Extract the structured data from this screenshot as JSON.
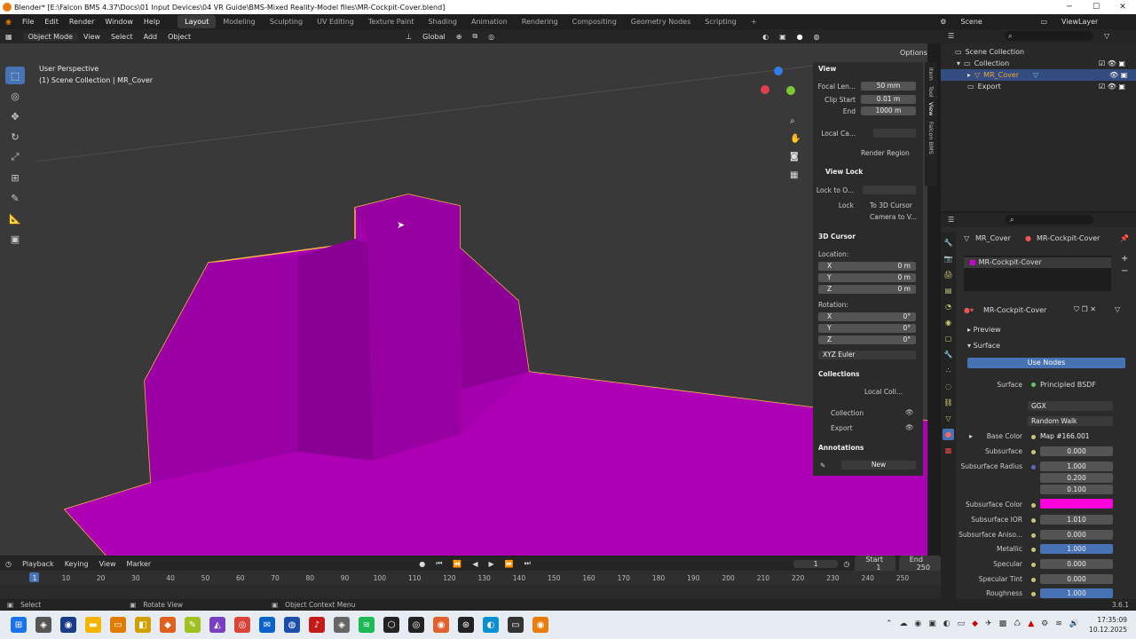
{
  "window": {
    "title": "Blender* [E:\\Falcon BMS 4.37\\Docs\\01 Input Devices\\04 VR Guide\\BMS-Mixed Reality-Model files\\MR-Cockpit-Cover.blend]"
  },
  "menu": {
    "items": [
      "File",
      "Edit",
      "Render",
      "Window",
      "Help"
    ]
  },
  "workspaces": [
    "Layout",
    "Modeling",
    "Sculpting",
    "UV Editing",
    "Texture Paint",
    "Shading",
    "Animation",
    "Rendering",
    "Compositing",
    "Geometry Nodes",
    "Scripting"
  ],
  "top_right": {
    "scene": "Scene",
    "view_layer": "ViewLayer"
  },
  "viewport_header": {
    "mode": "Object Mode",
    "view": "View",
    "select": "Select",
    "add": "Add",
    "object": "Object",
    "orientation": "Global",
    "options": "Options"
  },
  "viewport": {
    "perspective": "User Perspective",
    "collection_info": "(1) Scene Collection | MR_Cover"
  },
  "npanel": {
    "tabs": [
      "Item",
      "Tool",
      "View",
      "Falcon BMS"
    ],
    "view_section": "View",
    "focal_label": "Focal Len...",
    "focal_value": "50 mm",
    "clip_start_label": "Clip Start",
    "clip_start_value": "0.01 m",
    "end_label": "End",
    "end_value": "1000 m",
    "local_camera_label": "Local Ca...",
    "render_region": "Render Region",
    "view_lock_section": "View Lock",
    "lock_to_label": "Lock to O...",
    "lock_label": "Lock",
    "to_3d_cursor": "To 3D Cursor",
    "camera_to_view": "Camera to V...",
    "cursor_section": "3D Cursor",
    "location_label": "Location:",
    "loc_x_label": "X",
    "loc_x": "0 m",
    "loc_y_label": "Y",
    "loc_y": "0 m",
    "loc_z_label": "Z",
    "loc_z": "0 m",
    "rotation_label": "Rotation:",
    "rot_x_label": "X",
    "rot_x": "0°",
    "rot_y_label": "Y",
    "rot_y": "0°",
    "rot_z_label": "Z",
    "rot_z": "0°",
    "rotation_mode": "XYZ Euler",
    "collections_section": "Collections",
    "local_collections": "Local Coll...",
    "coll1": "Collection",
    "coll2": "Export",
    "annotations_section": "Annotations",
    "new_button": "New"
  },
  "outliner": {
    "scene_collection": "Scene Collection",
    "collection": "Collection",
    "object": "MR_Cover",
    "export": "Export"
  },
  "properties": {
    "breadcrumb_object": "MR_Cover",
    "breadcrumb_material": "MR-Cockpit-Cover",
    "slot": "MR-Cockpit-Cover",
    "material": "MR-Cockpit-Cover",
    "preview": "Preview",
    "surface_section": "Surface",
    "use_nodes": "Use Nodes",
    "surface_label": "Surface",
    "surface_value": "Principled BSDF",
    "distribution": "GGX",
    "subsurface_method": "Random Walk",
    "rows": [
      {
        "label": "Base Color",
        "value": "Map #166.001",
        "kind": "text"
      },
      {
        "label": "Subsurface",
        "value": "0.000",
        "kind": "num"
      },
      {
        "label": "Subsurface Radius",
        "value": "1.000",
        "kind": "num"
      },
      {
        "label": "",
        "value": "0.200",
        "kind": "num"
      },
      {
        "label": "",
        "value": "0.100",
        "kind": "num"
      },
      {
        "label": "Subsurface Color",
        "value": "",
        "kind": "color"
      },
      {
        "label": "Subsurface IOR",
        "value": "1.010",
        "kind": "num"
      },
      {
        "label": "Subsurface Aniso...",
        "value": "0.000",
        "kind": "num"
      },
      {
        "label": "Metallic",
        "value": "1.000",
        "kind": "blue"
      },
      {
        "label": "Specular",
        "value": "0.000",
        "kind": "num"
      },
      {
        "label": "Specular Tint",
        "value": "0.000",
        "kind": "num"
      },
      {
        "label": "Roughness",
        "value": "1.000",
        "kind": "blue"
      }
    ],
    "subsurface_color": "#ff00dd"
  },
  "timeline": {
    "playback": "Playback",
    "keying": "Keying",
    "view": "View",
    "marker": "Marker",
    "current_frame": "1",
    "start_label": "Start",
    "start": "1",
    "end_label": "End",
    "end": "250",
    "ticks": [
      "1",
      "10",
      "20",
      "30",
      "40",
      "50",
      "60",
      "70",
      "80",
      "90",
      "100",
      "110",
      "120",
      "130",
      "140",
      "150",
      "160",
      "170",
      "180",
      "190",
      "200",
      "210",
      "220",
      "230",
      "240",
      "250"
    ]
  },
  "status": {
    "select": "Select",
    "rotate": "Rotate View",
    "context": "Object Context Menu",
    "version": "3.6.1"
  },
  "taskbar": {
    "time": "17:35:09",
    "date": "10.12.2025"
  },
  "colors": {
    "mesh": "#a800b0",
    "accent": "#4772b3",
    "outline": "#ffb24a"
  }
}
